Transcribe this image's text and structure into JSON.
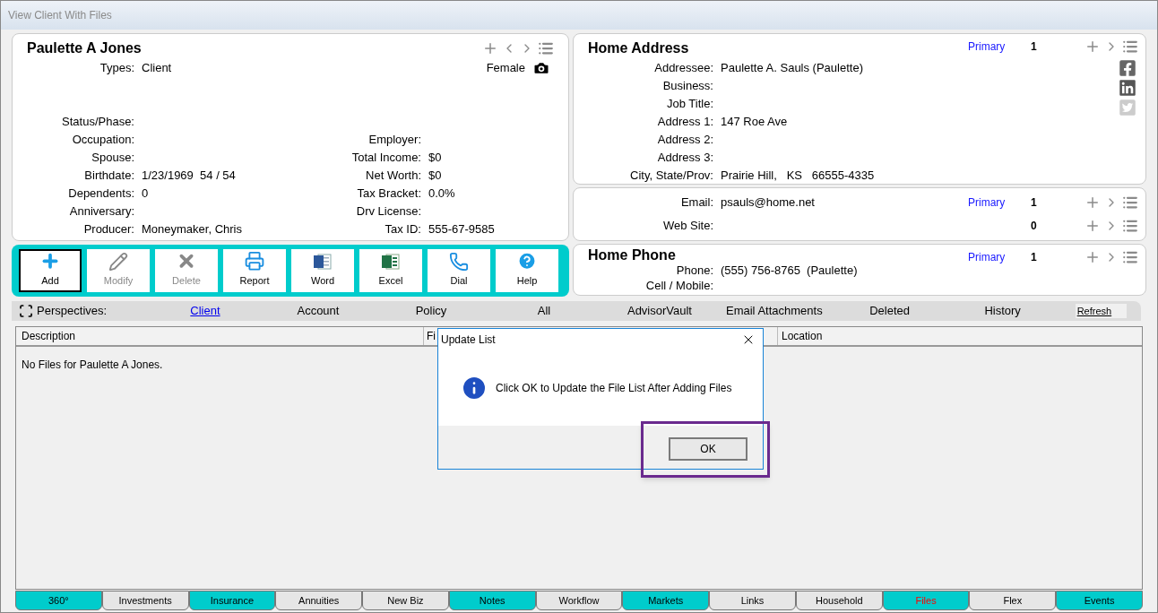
{
  "window": {
    "title": "View Client With Files"
  },
  "client": {
    "name": "Paulette A Jones",
    "types_label": "Types:",
    "types": "Client",
    "gender": "Female",
    "left_fields": [
      {
        "label": "Status/Phase:"
      },
      {
        "label": "Occupation:"
      },
      {
        "label": "Spouse:"
      },
      {
        "label": "Birthdate:",
        "value": "1/23/1969  54 / 54"
      },
      {
        "label": "Dependents:",
        "value": "0"
      },
      {
        "label": "Anniversary:"
      },
      {
        "label": "Producer:",
        "value": "Moneymaker, Chris"
      }
    ],
    "right_fields": [
      {
        "label": "Employer:"
      },
      {
        "label": "Total Income:",
        "value": "$0"
      },
      {
        "label": "Net Worth:",
        "value": "$0"
      },
      {
        "label": "Tax Bracket:",
        "value": "0.0%"
      },
      {
        "label": "Drv License:"
      },
      {
        "label": "Tax ID:",
        "value": "555-67-9585"
      }
    ]
  },
  "address": {
    "title": "Home Address",
    "primary": "Primary",
    "count": "1",
    "fields": [
      {
        "label": "Addressee:",
        "value": "Paulette A. Sauls (Paulette)"
      },
      {
        "label": "Business:"
      },
      {
        "label": "Job Title:"
      },
      {
        "label": "Address 1:",
        "value": "147 Roe Ave"
      },
      {
        "label": "Address 2:"
      },
      {
        "label": "Address 3:"
      },
      {
        "label": "City, State/Prov:",
        "value": "Prairie Hill,   KS   66555-4335"
      }
    ]
  },
  "contact": [
    {
      "label": "Email:",
      "value": "psauls@home.net",
      "primary": "Primary",
      "count": "1"
    },
    {
      "label": "Web Site:",
      "count": "0"
    }
  ],
  "phone": {
    "title": "Home Phone",
    "primary": "Primary",
    "count": "1",
    "fields": [
      {
        "label": "Phone:",
        "value": "(555) 756-8765  (Paulette)"
      },
      {
        "label": "Cell / Mobile:"
      }
    ]
  },
  "toolbar": [
    {
      "label": "Add",
      "selected": true,
      "disabled": false
    },
    {
      "label": "Modify",
      "selected": false,
      "disabled": true
    },
    {
      "label": "Delete",
      "selected": false,
      "disabled": true
    },
    {
      "label": "Report",
      "selected": false,
      "disabled": false
    },
    {
      "label": "Word",
      "selected": false,
      "disabled": false
    },
    {
      "label": "Excel",
      "selected": false,
      "disabled": false
    },
    {
      "label": "Dial",
      "selected": false,
      "disabled": false
    },
    {
      "label": "Help",
      "selected": false,
      "disabled": false
    }
  ],
  "perspectives": {
    "label": "Perspectives:",
    "items": [
      {
        "label": "Client",
        "selected": true
      },
      {
        "label": "Account",
        "selected": false
      },
      {
        "label": "Policy",
        "selected": false
      },
      {
        "label": "All",
        "selected": false
      },
      {
        "label": "AdvisorVault",
        "selected": false
      },
      {
        "label": "Email Attachments",
        "selected": false
      },
      {
        "label": "Deleted",
        "selected": false
      },
      {
        "label": "History",
        "selected": false
      }
    ],
    "refresh": "Refresh"
  },
  "file_list": {
    "columns": [
      "Description",
      "Fi",
      "Location"
    ],
    "empty_message": "No Files for Paulette A Jones."
  },
  "dialog": {
    "title": "Update List",
    "message": "Click OK to Update the File List After Adding Files",
    "button": "OK"
  },
  "tabs": [
    {
      "label": "360°",
      "color": "#00cccc",
      "selected": false
    },
    {
      "label": "Investments",
      "color": "#e6e6e6",
      "selected": false
    },
    {
      "label": "Insurance",
      "color": "#00cccc",
      "selected": false
    },
    {
      "label": "Annuities",
      "color": "#e6e6e6",
      "selected": false
    },
    {
      "label": "New Biz",
      "color": "#e6e6e6",
      "selected": false
    },
    {
      "label": "Notes",
      "color": "#00cccc",
      "selected": false
    },
    {
      "label": "Workflow",
      "color": "#e6e6e6",
      "selected": false
    },
    {
      "label": "Markets",
      "color": "#00cccc",
      "selected": false
    },
    {
      "label": "Links",
      "color": "#e6e6e6",
      "selected": false
    },
    {
      "label": "Household",
      "color": "#e6e6e6",
      "selected": false
    },
    {
      "label": "Files",
      "color": "#00cccc",
      "selected": true
    },
    {
      "label": "Flex",
      "color": "#e6e6e6",
      "selected": false
    },
    {
      "label": "Events",
      "color": "#00cccc",
      "selected": false
    }
  ]
}
